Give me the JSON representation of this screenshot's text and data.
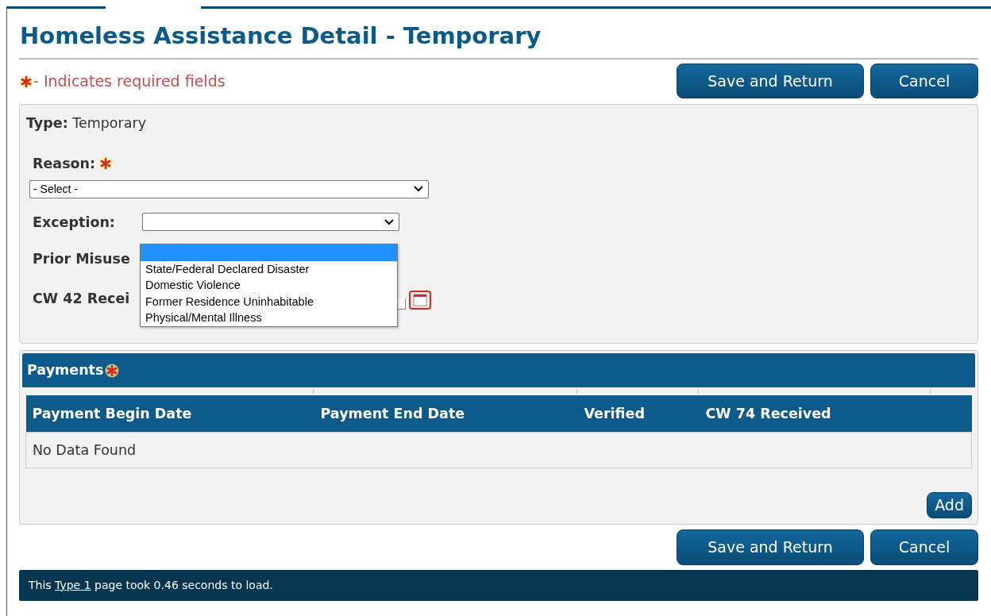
{
  "title": "Homeless Assistance Detail - Temporary",
  "required_note": "- Indicates required fields",
  "top_buttons": [
    "Save and Return",
    "Cancel"
  ],
  "type": {
    "label": "Type:",
    "value": "Temporary"
  },
  "reason": {
    "label": "Reason:",
    "required": true,
    "value": "- Select -"
  },
  "exception": {
    "label": "Exception:",
    "expanded": true,
    "options": [
      {
        "selected": true
      },
      {
        "label": "State/Federal Declared Disaster",
        "selected": false
      },
      {
        "label": "Domestic Violence",
        "selected": false
      },
      {
        "label": "Former Residence Uninhabitable",
        "selected": false
      },
      {
        "label": "Physical/Mental Illness",
        "selected": false
      }
    ]
  },
  "prior_misuse": {
    "label": "Prior Misuse"
  },
  "cw42": {
    "label": "CW 42 Recei"
  },
  "payments": {
    "title": "Payments",
    "required": true,
    "columns": [
      "Payment Begin Date",
      "Payment End Date",
      "Verified",
      "CW 74 Received"
    ],
    "empty_text": "No Data Found",
    "add_button": "Add"
  },
  "bottom_buttons": [
    "Save and Return",
    "Cancel"
  ],
  "footer": {
    "before": "This",
    "link": "Type 1",
    "after": "page took 0.46 seconds to load."
  }
}
